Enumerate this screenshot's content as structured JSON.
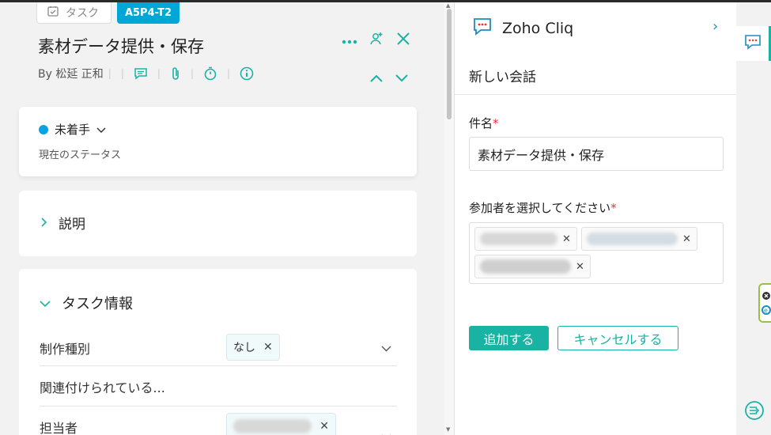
{
  "task": {
    "tag_label": "タスク",
    "id": "A5P4-T2",
    "title": "素材データ提供・保存",
    "by": "By 松延 正和"
  },
  "status": {
    "value": "未着手",
    "caption": "現在のステータス",
    "dot_color": "#0aa2e0"
  },
  "description": {
    "label": "説明"
  },
  "task_info": {
    "heading": "タスク情報",
    "fields": [
      {
        "label": "制作種別",
        "chip": "なし"
      },
      {
        "label": "関連付けられている..."
      },
      {
        "label": "担当者"
      }
    ]
  },
  "cliq": {
    "app_name": "Zoho Cliq",
    "subtitle": "新しい会話",
    "subject_label": "件名",
    "subject_required": "*",
    "subject_value": "素材データ提供・保存",
    "participants_label": "参加者を選択してください",
    "participants_required": "*",
    "add_button": "追加する",
    "cancel_button": "キャンセルする"
  },
  "colors": {
    "accent": "#19b3a3",
    "id_badge": "#00a6d6",
    "required": "#e0393e"
  }
}
